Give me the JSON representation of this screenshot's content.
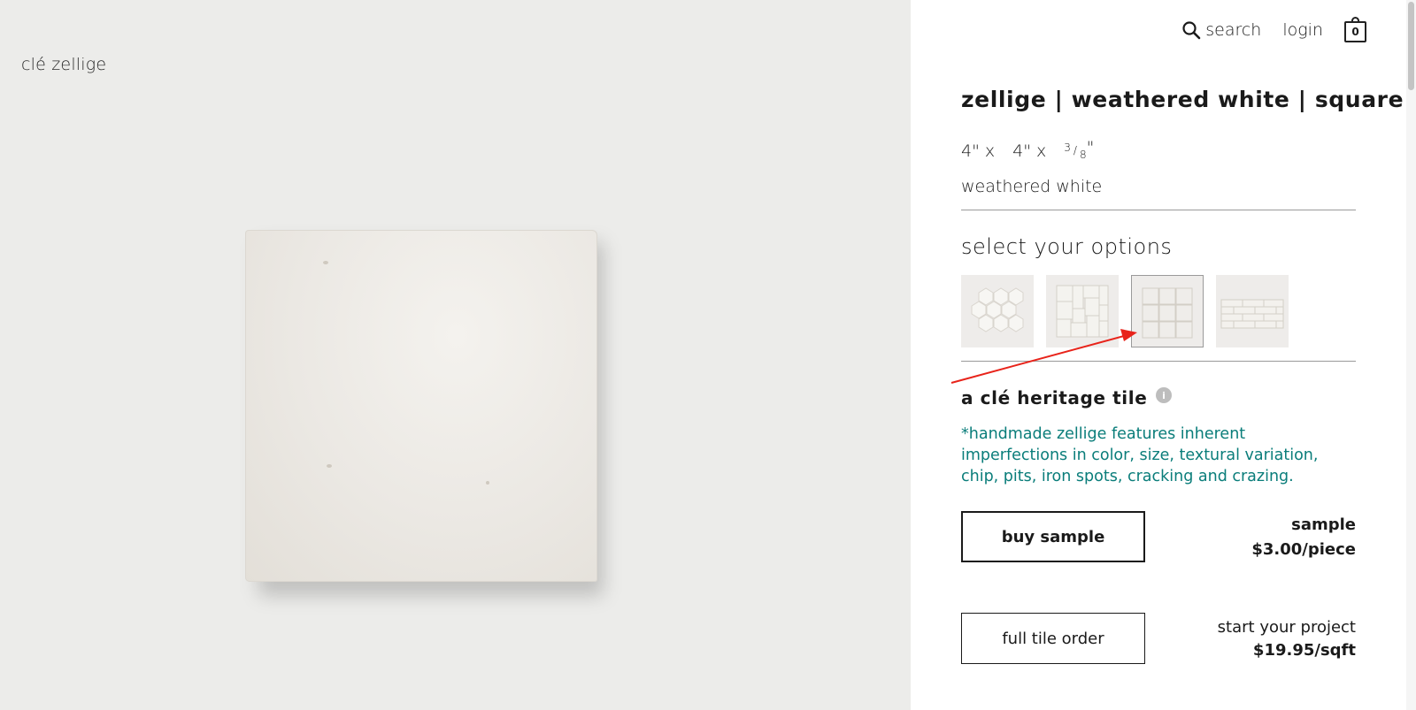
{
  "brand": {
    "name": "clé zellige"
  },
  "nav": {
    "search_label": "search",
    "login_label": "login",
    "cart_count": "0"
  },
  "product": {
    "title": "zellige | weathered white | square",
    "dims": {
      "w": "4\" x",
      "h": "4\" x",
      "t_num": "3",
      "t_den": "8",
      "t_unit": "\""
    },
    "color": "weathered white"
  },
  "options": {
    "heading": "select your options",
    "swatches": [
      {
        "name": "hexagon-swatch",
        "selected": false
      },
      {
        "name": "picket-swatch",
        "selected": false
      },
      {
        "name": "square-swatch",
        "selected": true
      },
      {
        "name": "subway-swatch",
        "selected": false
      }
    ]
  },
  "heritage": {
    "label": "a clé heritage tile",
    "info_icon": "i",
    "note": "*handmade zellige features inherent imperfections in color, size, textural variation, chip, pits, iron spots, cracking and crazing."
  },
  "purchase": {
    "sample_button": "buy sample",
    "sample_label": "sample",
    "sample_price": "$3.00/piece",
    "full_button": "full tile order",
    "full_label": "start your project",
    "full_price": "$19.95/sqft"
  },
  "colors": {
    "accent_teal": "#0a7d7a",
    "annotation_arrow": "#e8231a",
    "image_bg": "#ececea"
  }
}
